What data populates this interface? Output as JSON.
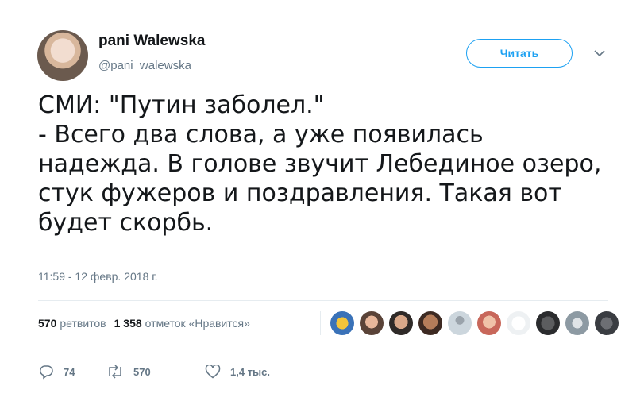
{
  "user": {
    "display_name": "pani Walewska",
    "handle": "@pani_walewska"
  },
  "follow_button": {
    "label": "Читать"
  },
  "tweet": {
    "lines": [
      "СМИ: \"Путин заболел.\"",
      "- Всего два слова, а уже появилась",
      "надежда. В голове звучит Лебединое озеро,",
      "стук фужеров и поздравления. Такая вот",
      "будет скорбь."
    ],
    "timestamp": "11:59 - 12 февр. 2018 г."
  },
  "stats": {
    "retweets_count": "570",
    "retweets_label": "ретвитов",
    "likes_count": "1 358",
    "likes_label": "отметок «Нравится»"
  },
  "actions": {
    "reply_count": "74",
    "retweet_count": "570",
    "like_count": "1,4 тыс."
  },
  "colors": {
    "accent": "#1da1f2",
    "muted": "#657786",
    "text": "#14171a",
    "divider": "#e6ecf0"
  }
}
